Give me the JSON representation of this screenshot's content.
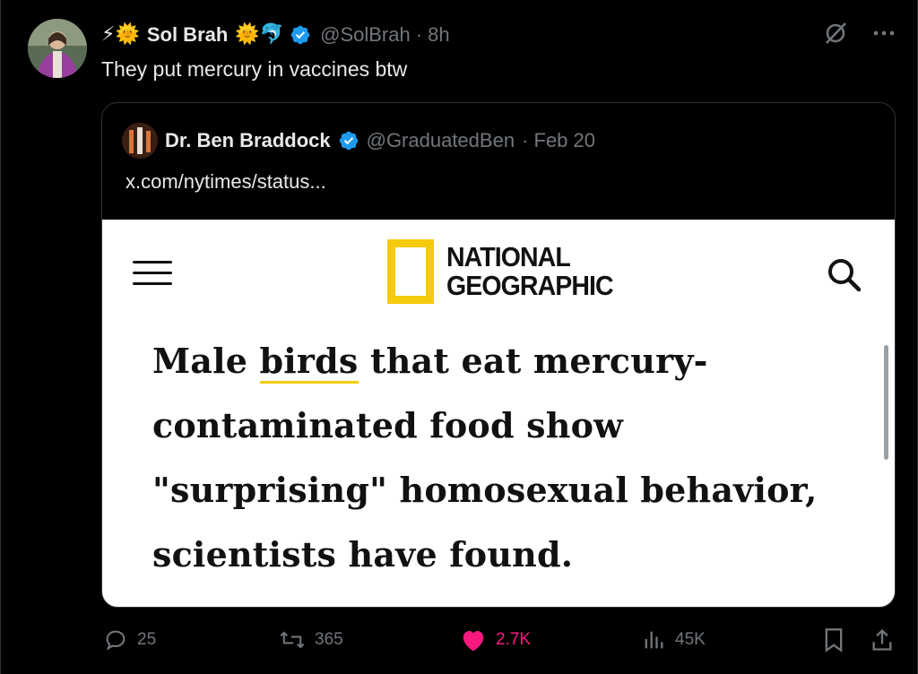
{
  "tweet": {
    "author": {
      "name": "Sol Brah",
      "emoji_before": "⚡🌞",
      "emoji_after": "🌞🐬",
      "handle": "@SolBrah",
      "time": "· 8h"
    },
    "text": "They put mercury in vaccines btw"
  },
  "quote": {
    "author": {
      "name": "Dr. Ben Braddock",
      "handle": "@GraduatedBen",
      "time": "· Feb 20"
    },
    "text": "x.com/nytimes/status...",
    "image": {
      "brand_line1": "NATIONAL",
      "brand_line2": "GEOGRAPHIC",
      "headline_part1": "Male ",
      "headline_link": "birds",
      "headline_part2": " that eat mercury-contaminated food show \"surprising\" homosexual behavior, scientists have found."
    }
  },
  "actions": {
    "replies": "25",
    "reposts": "365",
    "likes": "2.7K",
    "views": "45K"
  },
  "icons": [
    "grok-icon",
    "more-icon",
    "verified-badge-icon",
    "menu-icon",
    "search-icon",
    "reply-icon",
    "repost-icon",
    "like-icon",
    "views-icon",
    "bookmark-icon",
    "share-icon"
  ],
  "colors": {
    "verified": "#1d9bf0",
    "like": "#f91880",
    "natgeo_yellow": "#f5cb0d",
    "muted": "#71767b"
  }
}
